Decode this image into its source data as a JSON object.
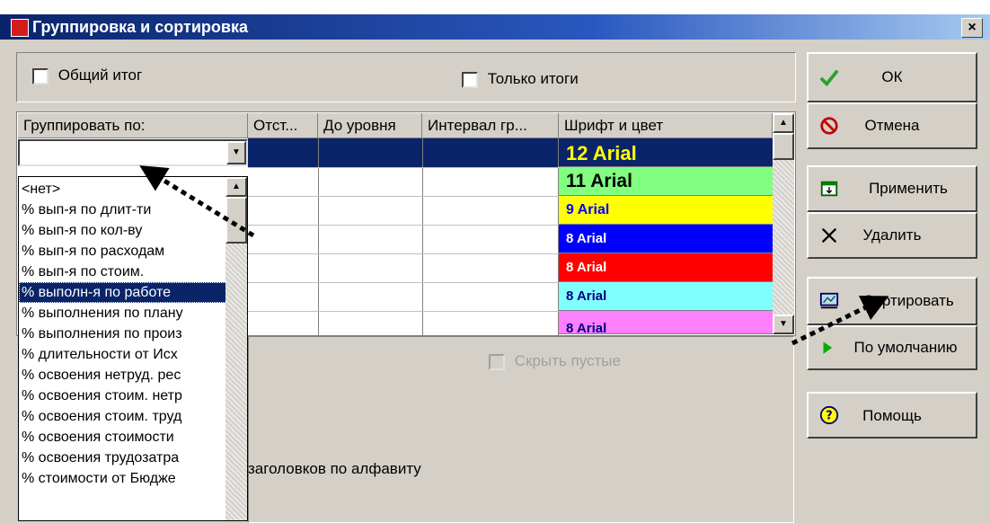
{
  "window": {
    "title": "Группировка и сортировка",
    "close_glyph": "×"
  },
  "top_options": {
    "total_label": "Общий итог",
    "only_totals_label": "Только итоги"
  },
  "columns": [
    "Группировать по:",
    "Отст...",
    "До уровня",
    "Интервал гр...",
    "Шрифт и цвет"
  ],
  "combo": {
    "value": ""
  },
  "font_rows": [
    {
      "label": "12 Arial",
      "bg": "#0a246a",
      "fg": "#ffff00"
    },
    {
      "label": "11 Arial",
      "bg": "#80ff80",
      "fg": "#000000"
    },
    {
      "label": "9 Arial",
      "bg": "#ffff00",
      "fg": "#0000ff"
    },
    {
      "label": "8 Arial",
      "bg": "#0000ff",
      "fg": "#ffffff"
    },
    {
      "label": "8 Arial",
      "bg": "#ff0000",
      "fg": "#ffffff"
    },
    {
      "label": "8 Arial",
      "bg": "#80ffff",
      "fg": "#000080"
    },
    {
      "label": "8 Arial",
      "bg": "#ff80ff",
      "fg": "#000080"
    }
  ],
  "dropdown_items": [
    "<нет>",
    "% вып-я по длит-ти",
    "% вып-я по кол-ву",
    "% вып-я по расходам",
    "% вып-я по стоим.",
    "% выполн-я по работе",
    "% выполнения по плану",
    "% выполнения по произ",
    "% длительности от Исх",
    "% освоения нетруд. рес",
    "% освоения стоим. нетр",
    "% освоения стоим. труд",
    "% освоения стоимости",
    "% освоения трудозатра",
    "% стоимости от Бюдже"
  ],
  "selected_index": 5,
  "hide_empty_label": "Скрыть пустые",
  "sort_headers_label": "заголовков по алфавиту",
  "buttons": {
    "ok": "ОК",
    "cancel": "Отмена",
    "apply": "Применить",
    "delete": "Удалить",
    "sort": "Сортировать",
    "default": "По умолчанию",
    "help": "Помощь"
  }
}
